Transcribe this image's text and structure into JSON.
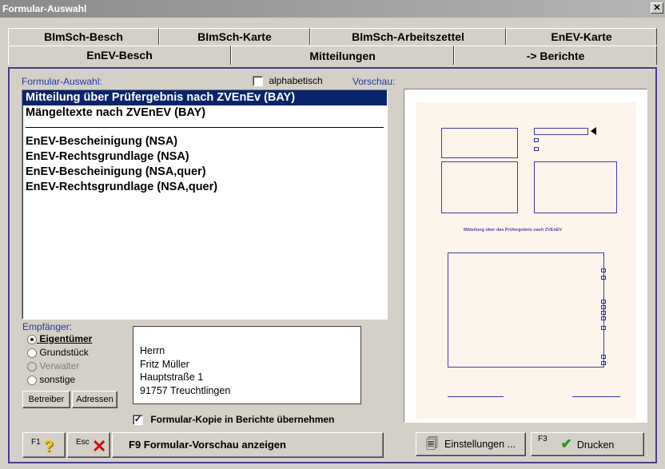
{
  "window": {
    "title": "Formular-Auswahl",
    "close": "✕"
  },
  "tabs_top": [
    "BImSch-Besch",
    "BImSch-Karte",
    "BImSch-Arbeitszettel",
    "EnEV-Karte"
  ],
  "tabs_bottom": [
    "EnEV-Besch",
    "Mitteilungen",
    "-> Berichte"
  ],
  "form_select": {
    "label": "Formular-Auswahl:",
    "alpha_label": "alphabetisch",
    "alpha_checked": false,
    "preview_label": "Vorschau:"
  },
  "forms": {
    "group1": [
      "Mitteilung über Prüfergebnis nach ZVEnEv (BAY)",
      "Mängeltexte nach ZVEnEV (BAY)"
    ],
    "group2": [
      "EnEV-Bescheinigung  (NSA)",
      "EnEV-Rechtsgrundlage (NSA)",
      "EnEV-Bescheinigung  (NSA,quer)",
      "EnEV-Rechtsgrundlage (NSA,quer)"
    ]
  },
  "recipient": {
    "label": "Empfänger:",
    "options": [
      "Eigentümer",
      "Grundstück",
      "Verwalter",
      "sonstige"
    ],
    "selected": "Eigentümer"
  },
  "buttons": {
    "betreiber": "Betreiber",
    "adressen": "Adressen",
    "f1": "F1",
    "esc": "Esc",
    "preview": "F9  Formular-Vorschau anzeigen",
    "settings": "Einstellungen ...",
    "f3": "F3",
    "print": "Drucken"
  },
  "address": [
    "Herrn",
    "Fritz Müller",
    "Hauptstraße 1",
    "91757 Treuchtlingen"
  ],
  "copy": {
    "label": "Formular-Kopie in Berichte übernehmen",
    "checked": true
  },
  "preview_doc": {
    "heading": "Mitteilung über das Prüfergebnis nach ZVEnEV"
  },
  "colors": {
    "selection": "#0a246a",
    "accent": "#4b3b8a",
    "label_blue": "#21389b"
  }
}
